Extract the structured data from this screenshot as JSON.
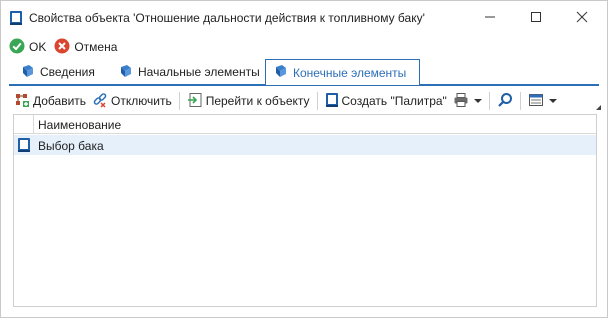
{
  "window": {
    "title": "Свойства объекта 'Отношение дальности действия к топливному баку'",
    "controls": [
      "minimize-icon",
      "maximize-icon",
      "close-icon"
    ]
  },
  "actions": {
    "ok_label": "OK",
    "cancel_label": "Отмена"
  },
  "tabs": [
    {
      "label": "Сведения",
      "active": false
    },
    {
      "label": "Начальные элементы",
      "active": false
    },
    {
      "label": "Конечные элементы",
      "active": true
    }
  ],
  "toolbar": {
    "add_label": "Добавить",
    "disconnect_label": "Отключить",
    "goto_label": "Перейти к объекту",
    "create_label": "Создать \"Палитра\""
  },
  "grid": {
    "columns": [
      "Наименование"
    ],
    "rows": [
      {
        "name": "Выбор бака",
        "selected": true
      }
    ]
  },
  "colors": {
    "accent": "#2d6fb6",
    "selected_row": "#e5f0fb",
    "ok_green": "#3aa655",
    "cancel_red": "#d9452e"
  }
}
